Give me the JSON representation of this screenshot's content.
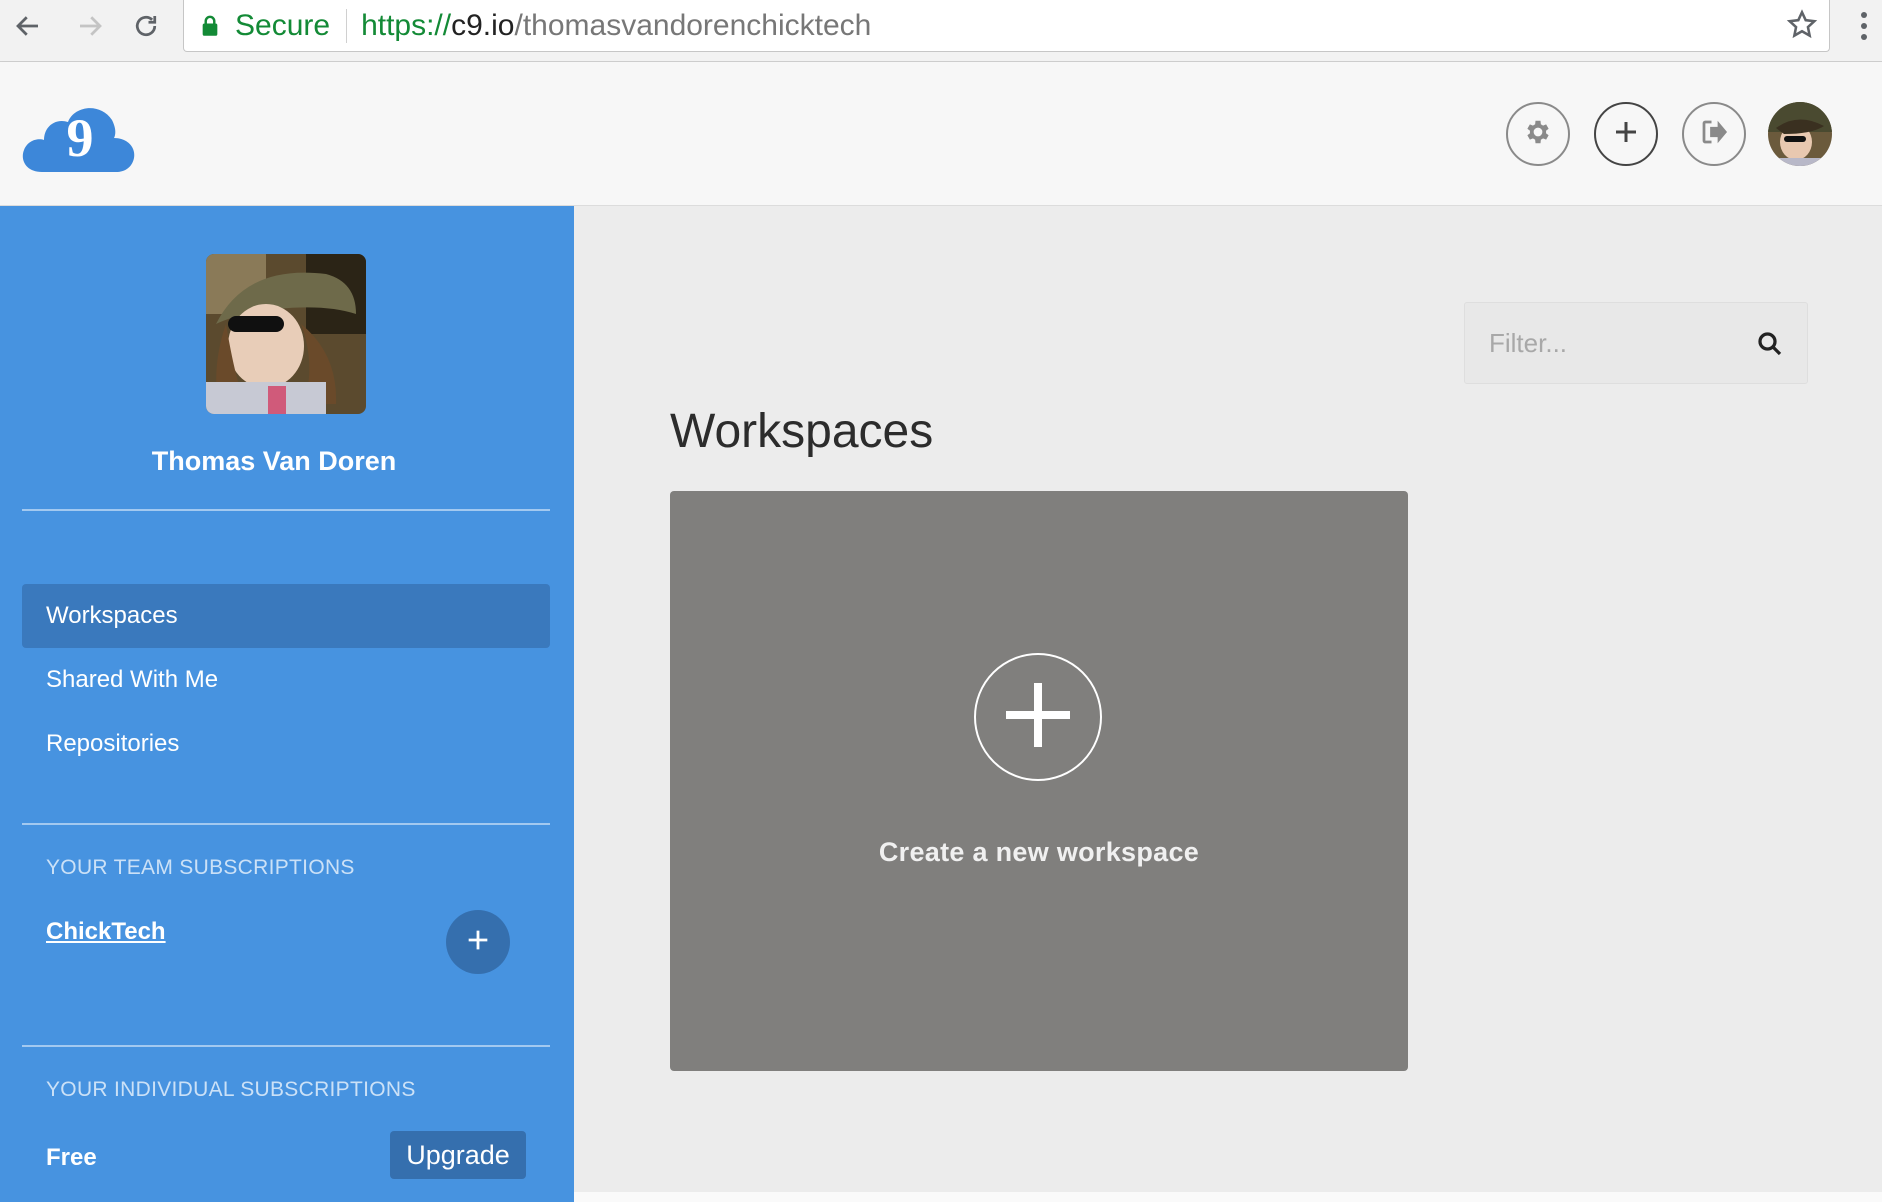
{
  "browser": {
    "secure_label": "Secure",
    "url_scheme": "https://",
    "url_host": "c9.io",
    "url_path": "/thomasvandorenchicktech"
  },
  "header": {
    "logo_icon": "cloud9-logo",
    "buttons": [
      {
        "name": "settings",
        "icon": "gear-icon"
      },
      {
        "name": "new-workspace",
        "icon": "plus-icon"
      },
      {
        "name": "sign-out",
        "icon": "sign-out-icon"
      }
    ]
  },
  "sidebar": {
    "user_name": "Thomas Van Doren",
    "nav": [
      {
        "label": "Workspaces",
        "active": true
      },
      {
        "label": "Shared With Me",
        "active": false
      },
      {
        "label": "Repositories",
        "active": false
      }
    ],
    "team_section_title": "YOUR TEAM SUBSCRIPTIONS",
    "team_name": "ChickTech",
    "individual_section_title": "YOUR INDIVIDUAL SUBSCRIPTIONS",
    "plan": "Free",
    "upgrade_label": "Upgrade"
  },
  "main": {
    "filter_placeholder": "Filter...",
    "title": "Workspaces",
    "create_label": "Create a new workspace"
  },
  "colors": {
    "sidebar_bg": "#4793e0",
    "sidebar_active": "#3a79bd",
    "accent_button": "#356fae",
    "card_bg": "#807f7d",
    "secure_green": "#138a36"
  }
}
